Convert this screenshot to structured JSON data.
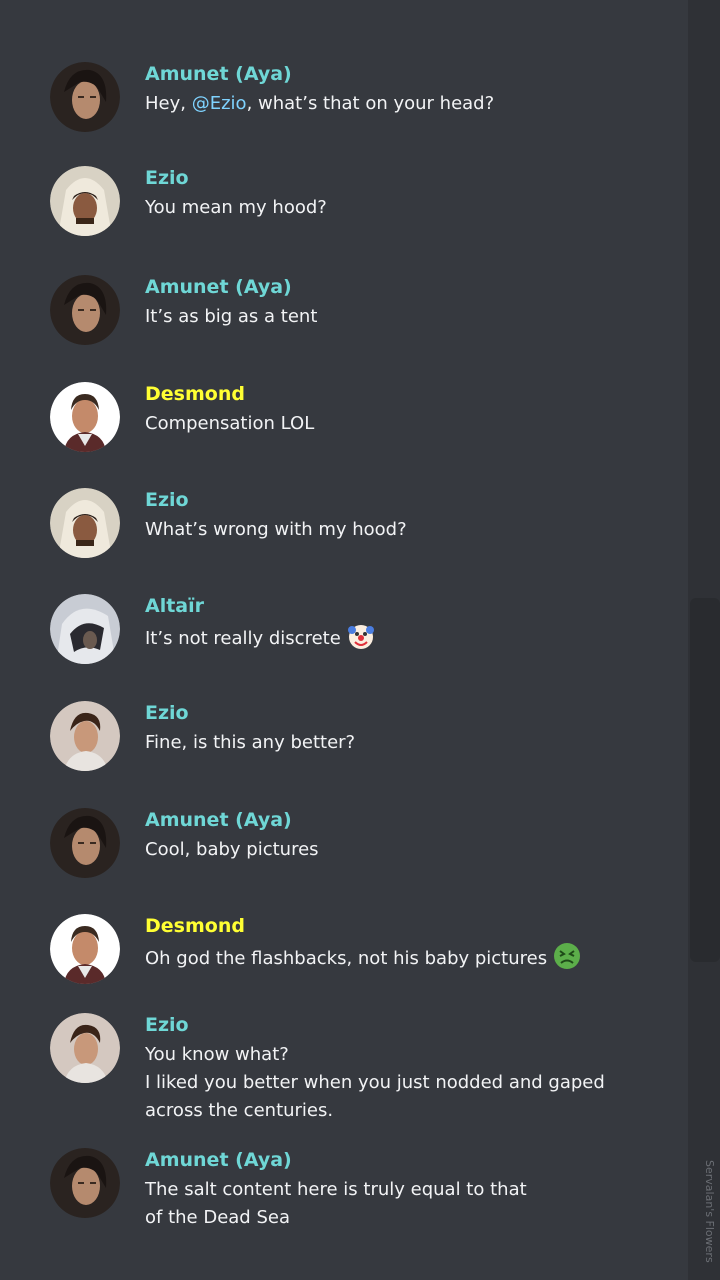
{
  "colors": {
    "background": "#36393f",
    "teal_name": "#6fd7d6",
    "yellow_name": "#ffff33",
    "mention": "#7fd3ff"
  },
  "messages": [
    {
      "author": "Amunet (Aya)",
      "name_color": "#6fd7d6",
      "avatar": "amunet-avatar",
      "parts": [
        "Hey, ",
        "@Ezio",
        ", what’s that on your head?"
      ]
    },
    {
      "author": "Ezio",
      "name_color": "#6fd7d6",
      "avatar": "ezio-hood-avatar",
      "text": "You mean my hood?"
    },
    {
      "author": "Amunet (Aya)",
      "name_color": "#6fd7d6",
      "avatar": "amunet-avatar",
      "text": "It’s as big as a tent"
    },
    {
      "author": "Desmond",
      "name_color": "#ffff33",
      "avatar": "desmond-avatar",
      "text": "Compensation LOL"
    },
    {
      "author": "Ezio",
      "name_color": "#6fd7d6",
      "avatar": "ezio-hood-avatar",
      "text": "What’s wrong with my hood?"
    },
    {
      "author": "Altaïr",
      "name_color": "#6fd7d6",
      "avatar": "altair-avatar",
      "text": "It’s not really discrete",
      "emoji": "clown-emoji"
    },
    {
      "author": "Ezio",
      "name_color": "#6fd7d6",
      "avatar": "young-ezio-avatar",
      "text": "Fine, is this any better?"
    },
    {
      "author": "Amunet (Aya)",
      "name_color": "#6fd7d6",
      "avatar": "amunet-avatar",
      "text": "Cool, baby pictures"
    },
    {
      "author": "Desmond",
      "name_color": "#ffff33",
      "avatar": "desmond-avatar",
      "text": "Oh god the flashbacks, not his baby pictures",
      "emoji": "nauseated-emoji"
    },
    {
      "author": "Ezio",
      "name_color": "#6fd7d6",
      "avatar": "young-ezio-avatar",
      "lines": [
        "You know what?",
        "I liked you better when you just nodded and gaped across the centuries."
      ]
    },
    {
      "author": "Amunet (Aya)",
      "name_color": "#6fd7d6",
      "avatar": "amunet-avatar",
      "text": "The salt content here is truly equal to that of the Dead Sea"
    }
  ],
  "watermark": "Servalan's Flowers"
}
